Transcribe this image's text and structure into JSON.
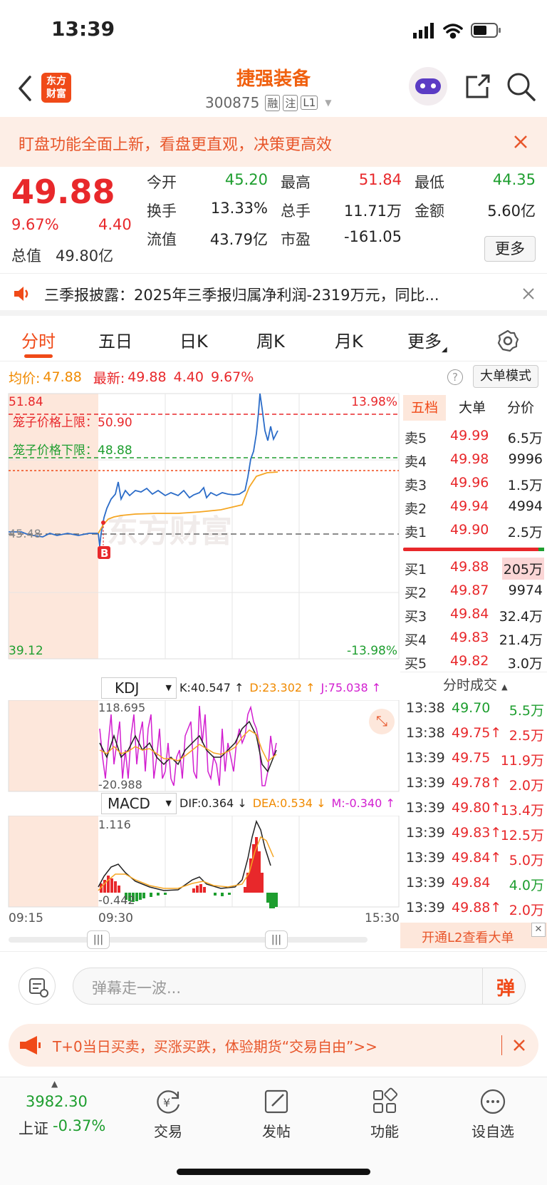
{
  "status": {
    "time": "13:39"
  },
  "header": {
    "title": "捷强装备",
    "code": "300875",
    "tags": [
      "融",
      "注",
      "L1"
    ]
  },
  "banner": {
    "text": "盯盘功能全面上新，看盘更直观，决策更高效"
  },
  "quote": {
    "price": "49.88",
    "pct": "9.67%",
    "chg": "4.40",
    "fields": [
      {
        "label": "今开",
        "value": "45.20",
        "color": "#1e9e2f"
      },
      {
        "label": "最高",
        "value": "51.84",
        "color": "#e8282b"
      },
      {
        "label": "最低",
        "value": "44.35",
        "color": "#1e9e2f"
      },
      {
        "label": "换手",
        "value": "13.33%",
        "color": "#222"
      },
      {
        "label": "总手",
        "value": "11.71万",
        "color": "#222"
      },
      {
        "label": "金额",
        "value": "5.60亿",
        "color": "#222"
      },
      {
        "label": "总值",
        "value": "49.80亿",
        "color": "#222"
      },
      {
        "label": "流值",
        "value": "43.79亿",
        "color": "#222"
      },
      {
        "label": "市盈",
        "value": "-161.05",
        "color": "#222"
      }
    ],
    "more_label": "更多"
  },
  "notice": {
    "text": "三季报披露：2025年三季报归属净利润-2319万元，同比..."
  },
  "tabs": [
    "分时",
    "五日",
    "日K",
    "周K",
    "月K",
    "更多"
  ],
  "info_line": {
    "avg_label": "均价:",
    "avg_value": "47.88",
    "latest_label": "最新:",
    "latest_value": "49.88",
    "chg": "4.40",
    "pct": "9.67%",
    "mode_label": "大单模式"
  },
  "chart_labels": {
    "top": "51.84",
    "bottom": "39.12",
    "top_pct": "13.98%",
    "bottom_pct": "-13.98%",
    "mid": "45.48",
    "upper_limit": "笼子价格上限：50.90",
    "lower_limit": "笼子价格下限：48.88",
    "marker": "B",
    "watermark": "东方财富"
  },
  "kdj": {
    "name": "KDJ",
    "k": "K:40.547 ↑",
    "d": "D:23.302 ↑",
    "j": "J:75.038 ↑",
    "max": "118.695",
    "min": "-20.988"
  },
  "macd": {
    "name": "MACD",
    "dif": "DIF:0.364 ↓",
    "dea": "DEA:0.534 ↓",
    "m": "M:-0.340 ↑",
    "max": "1.116",
    "min": "-0.442"
  },
  "time_axis": [
    "09:15",
    "09:30",
    "15:30"
  ],
  "order_book": {
    "tabs": [
      "五档",
      "大单",
      "分价"
    ],
    "sells": [
      {
        "label": "卖5",
        "price": "49.99",
        "vol": "6.5万"
      },
      {
        "label": "卖4",
        "price": "49.98",
        "vol": "9996"
      },
      {
        "label": "卖3",
        "price": "49.96",
        "vol": "1.5万"
      },
      {
        "label": "卖2",
        "price": "49.94",
        "vol": "4994"
      },
      {
        "label": "卖1",
        "price": "49.90",
        "vol": "2.5万"
      }
    ],
    "buys": [
      {
        "label": "买1",
        "price": "49.88",
        "vol": "205万"
      },
      {
        "label": "买2",
        "price": "49.87",
        "vol": "9974"
      },
      {
        "label": "买3",
        "price": "49.84",
        "vol": "32.4万"
      },
      {
        "label": "买4",
        "price": "49.83",
        "vol": "21.4万"
      },
      {
        "label": "买5",
        "price": "49.82",
        "vol": "3.0万"
      }
    ]
  },
  "trades": {
    "title": "分时成交",
    "rows": [
      {
        "time": "13:38",
        "price": "49.70",
        "vol": "5.5万",
        "pc": "#1e9e2f",
        "vc": "#1e9e2f"
      },
      {
        "time": "13:38",
        "price": "49.75↑",
        "vol": "2.5万",
        "pc": "#e8282b",
        "vc": "#e8282b"
      },
      {
        "time": "13:39",
        "price": "49.75",
        "vol": "11.9万",
        "pc": "#e8282b",
        "vc": "#e8282b"
      },
      {
        "time": "13:39",
        "price": "49.78↑",
        "vol": "2.0万",
        "pc": "#e8282b",
        "vc": "#e8282b"
      },
      {
        "time": "13:39",
        "price": "49.80↑",
        "vol": "13.4万",
        "pc": "#e8282b",
        "vc": "#e8282b"
      },
      {
        "time": "13:39",
        "price": "49.83↑",
        "vol": "12.5万",
        "pc": "#e8282b",
        "vc": "#e8282b"
      },
      {
        "time": "13:39",
        "price": "49.84↑",
        "vol": "5.0万",
        "pc": "#e8282b",
        "vc": "#e8282b"
      },
      {
        "time": "13:39",
        "price": "49.84",
        "vol": "4.0万",
        "pc": "#e8282b",
        "vc": "#1e9e2f"
      },
      {
        "time": "13:39",
        "price": "49.88↑",
        "vol": "2.0万",
        "pc": "#e8282b",
        "vc": "#e8282b"
      }
    ],
    "l2_label": "开通L2查看大单"
  },
  "comment": {
    "placeholder": "弹幕走一波...",
    "send": "弹"
  },
  "promo": {
    "text": "T+0当日买卖，买涨买跌，体验期货“交易自由”>>"
  },
  "bottom_nav": {
    "index_value": "3982.30",
    "index_name": "上证",
    "index_pct": "-0.37%",
    "items": [
      "交易",
      "发帖",
      "功能",
      "设自选"
    ]
  }
}
